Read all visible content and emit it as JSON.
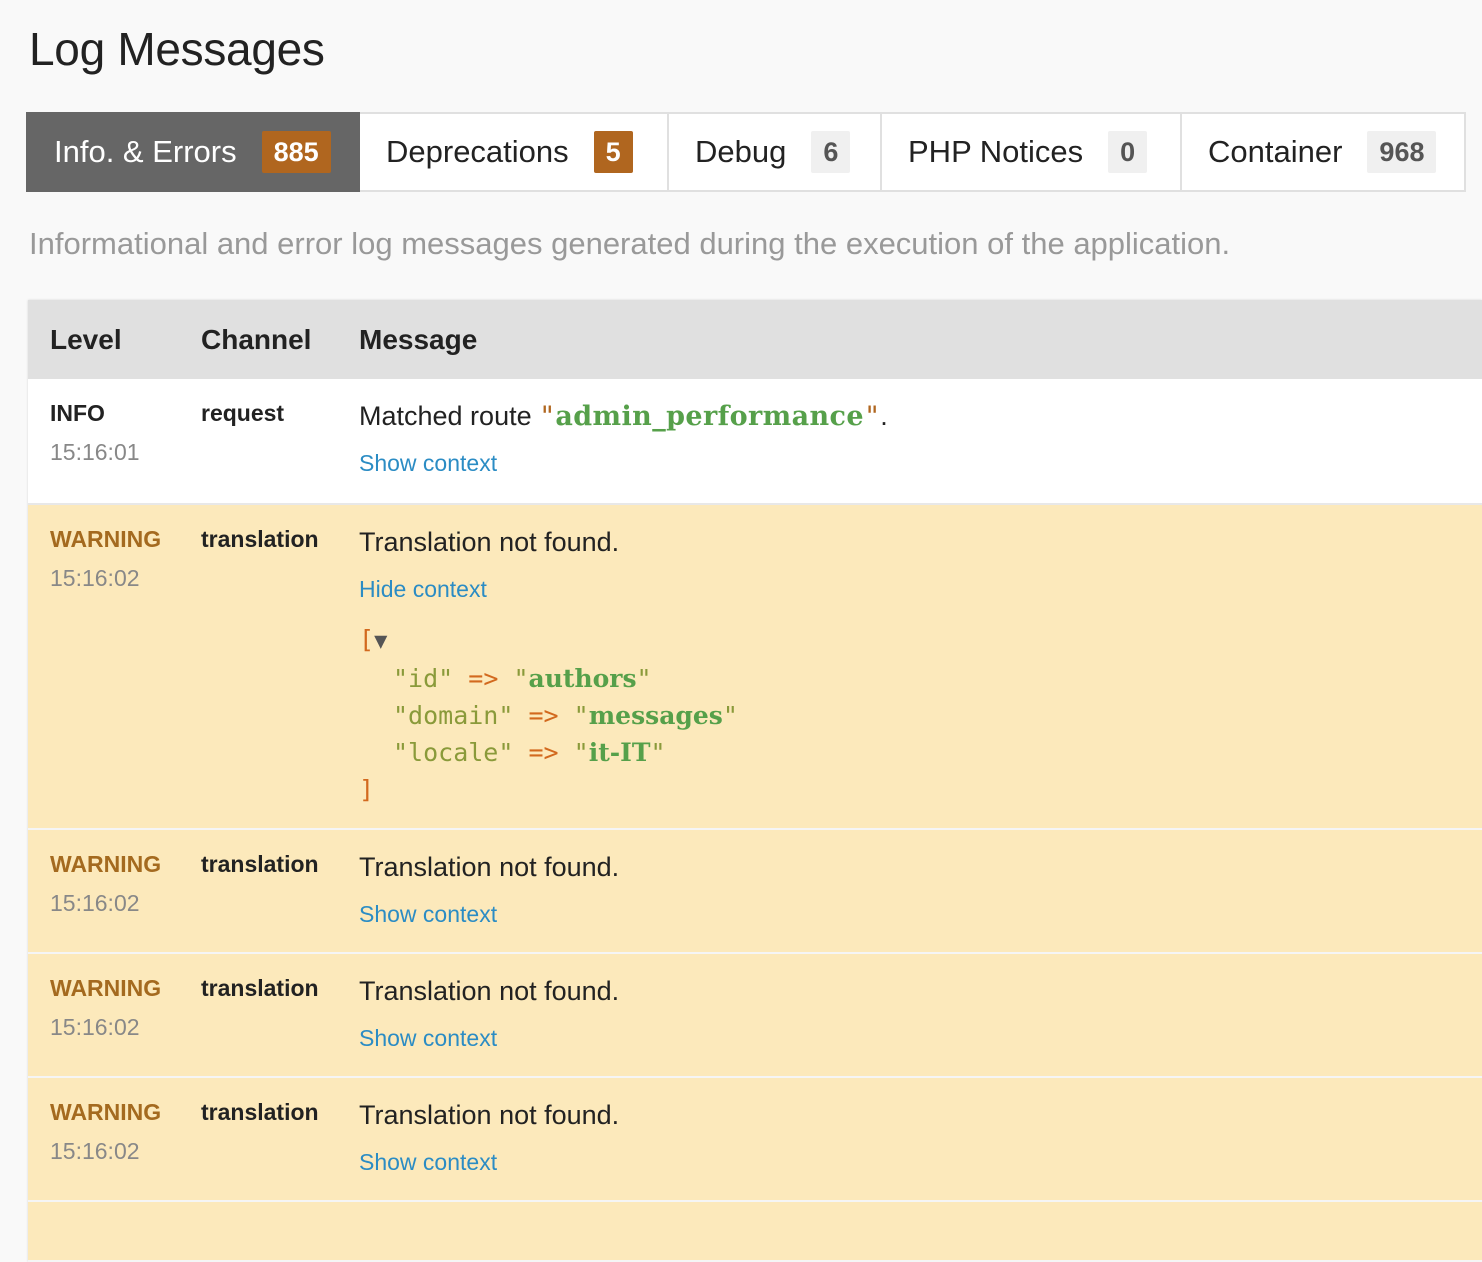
{
  "page": {
    "title": "Log Messages",
    "description": "Informational and error log messages generated during the execution of the application."
  },
  "tabs": [
    {
      "label": "Info. & Errors",
      "count": "885"
    },
    {
      "label": "Deprecations",
      "count": "5"
    },
    {
      "label": "Debug",
      "count": "6"
    },
    {
      "label": "PHP Notices",
      "count": "0"
    },
    {
      "label": "Container",
      "count": "968"
    }
  ],
  "table": {
    "headers": [
      "Level",
      "Channel",
      "Message"
    ],
    "rows": [
      {
        "level": "INFO",
        "time": "15:16:01",
        "channel": "request",
        "message_prefix": "Matched route ",
        "quote_open": "\"",
        "route": "admin_performance",
        "quote_close": "\"",
        "message_suffix": ".",
        "context_link": "Show context"
      },
      {
        "level": "WARNING",
        "time": "15:16:02",
        "channel": "translation",
        "message": "Translation not found.",
        "context_link": "Hide context",
        "context": {
          "open": "[",
          "toggle": "▼",
          "close": "]",
          "entries": [
            {
              "key": "\"id\"",
              "arrow": "=>",
              "value": "authors"
            },
            {
              "key": "\"domain\"",
              "arrow": "=>",
              "value": "messages"
            },
            {
              "key": "\"locale\"",
              "arrow": "=>",
              "value": "it-IT"
            }
          ]
        }
      },
      {
        "level": "WARNING",
        "time": "15:16:02",
        "channel": "translation",
        "message": "Translation not found.",
        "context_link": "Show context"
      },
      {
        "level": "WARNING",
        "time": "15:16:02",
        "channel": "translation",
        "message": "Translation not found.",
        "context_link": "Show context"
      },
      {
        "level": "WARNING",
        "time": "15:16:02",
        "channel": "translation",
        "message": "Translation not found.",
        "context_link": "Show context"
      }
    ]
  },
  "colors": {
    "active_tab": "#666666",
    "badge_warning": "#b0661f",
    "warning_row": "#fce9bb",
    "link": "#2b8cc4",
    "warning_text": "#a46a1f"
  }
}
